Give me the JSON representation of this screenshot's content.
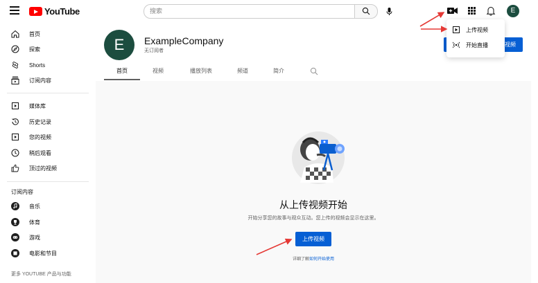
{
  "header": {
    "logo_text": "YouTube",
    "search_placeholder": "搜索",
    "avatar_letter": "E"
  },
  "create_menu": {
    "items": [
      {
        "label": "上传视频",
        "icon": "play-square-icon"
      },
      {
        "label": "开始直播",
        "icon": "live-broadcast-icon"
      }
    ]
  },
  "sidebar": {
    "items": [
      {
        "label": "首页",
        "icon": "home-icon"
      },
      {
        "label": "探索",
        "icon": "compass-icon"
      },
      {
        "label": "Shorts",
        "icon": "shorts-icon"
      },
      {
        "label": "订阅内容",
        "icon": "subscriptions-icon"
      },
      {
        "label": "媒体库",
        "icon": "library-icon"
      },
      {
        "label": "历史记录",
        "icon": "history-icon"
      },
      {
        "label": "您的视频",
        "icon": "your-videos-icon"
      },
      {
        "label": "稍后观看",
        "icon": "clock-icon"
      },
      {
        "label": "顶过的视频",
        "icon": "thumbs-up-icon"
      }
    ],
    "subscriptions_heading": "订阅内容",
    "subscriptions": [
      {
        "label": "音乐",
        "icon": "music-icon"
      },
      {
        "label": "体育",
        "icon": "trophy-icon"
      },
      {
        "label": "游戏",
        "icon": "gamepad-icon"
      },
      {
        "label": "电影和节目",
        "icon": "film-icon"
      }
    ],
    "footer": "更多 YOUTUBE 产品与功能"
  },
  "channel": {
    "avatar_letter": "E",
    "name": "ExampleCompany",
    "subscribers": "无订阅者",
    "right_button": "视频",
    "tabs": [
      "首页",
      "视频",
      "播放列表",
      "频道",
      "简介"
    ],
    "active_tab": "首页"
  },
  "empty_state": {
    "title": "从上传视频开始",
    "description": "开始分享您的故事与观众互动。您上传的视频会显示在这里。",
    "button": "上传视频",
    "learn_prefix": "详细了解",
    "learn_link": "如何开始使用"
  },
  "colors": {
    "accent_blue": "#065fd4",
    "brand_red": "#ff0000",
    "avatar_green": "#1c4d3f",
    "annotation_red": "#e53935"
  }
}
